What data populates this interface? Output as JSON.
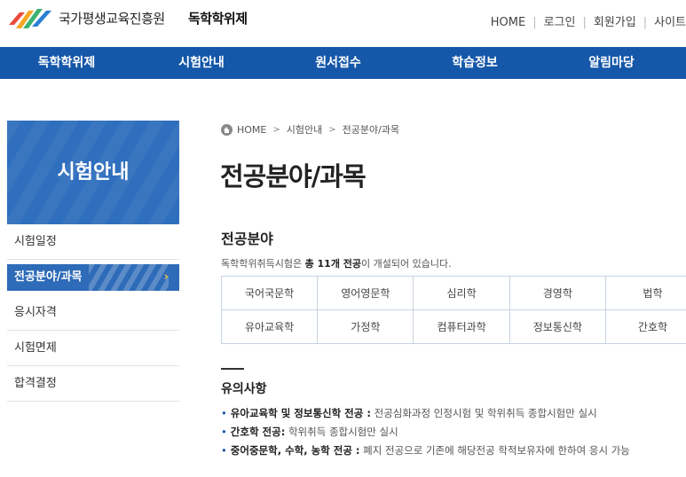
{
  "header": {
    "org_name": "국가평생교육진흥원",
    "site_name": "독학학위제",
    "util": [
      "HOME",
      "로그인",
      "회원가입",
      "사이트"
    ]
  },
  "gnb": [
    "독학학위제",
    "시험안내",
    "원서접수",
    "학습정보",
    "알림마당"
  ],
  "sidebar": {
    "title": "시험안내",
    "items": [
      "시험일정",
      "전공분야/과목",
      "응시자격",
      "시험면제",
      "합격결정"
    ],
    "active_arrow": "›"
  },
  "breadcrumb": [
    "HOME",
    "시험안내",
    "전공분야/과목"
  ],
  "page_title": "전공분야/과목",
  "section": {
    "title": "전공분야",
    "desc_prefix": "독학학위취득시험은 ",
    "desc_bold": "총 11개 전공",
    "desc_suffix": "이 개설되어 있습니다.",
    "majors_row1": [
      "국어국문학",
      "영어영문학",
      "심리학",
      "경영학",
      "법학"
    ],
    "majors_row2": [
      "유아교육학",
      "가정학",
      "컴퓨터과학",
      "정보통신학",
      "간호학"
    ]
  },
  "notice": {
    "title": "유의사항",
    "items": [
      {
        "bold": "유아교육학 및 정보통신학 전공 :",
        "text": " 전공심화과정 인정시험 및 학위취득 종합시험만 실시"
      },
      {
        "bold": "간호학 전공:",
        "text": " 학위취득 종합시험만 실시"
      },
      {
        "bold": "중어중문학, 수학, 농학 전공 :",
        "text": " 폐지 전공으로 기존에 해당전공 학적보유자에 한하여 응시 가능"
      }
    ]
  },
  "colors": {
    "primary": "#1557a8",
    "sidebar_title": "#2f6fbd",
    "active": "#2e6bb8",
    "arrow": "#f0c040"
  }
}
